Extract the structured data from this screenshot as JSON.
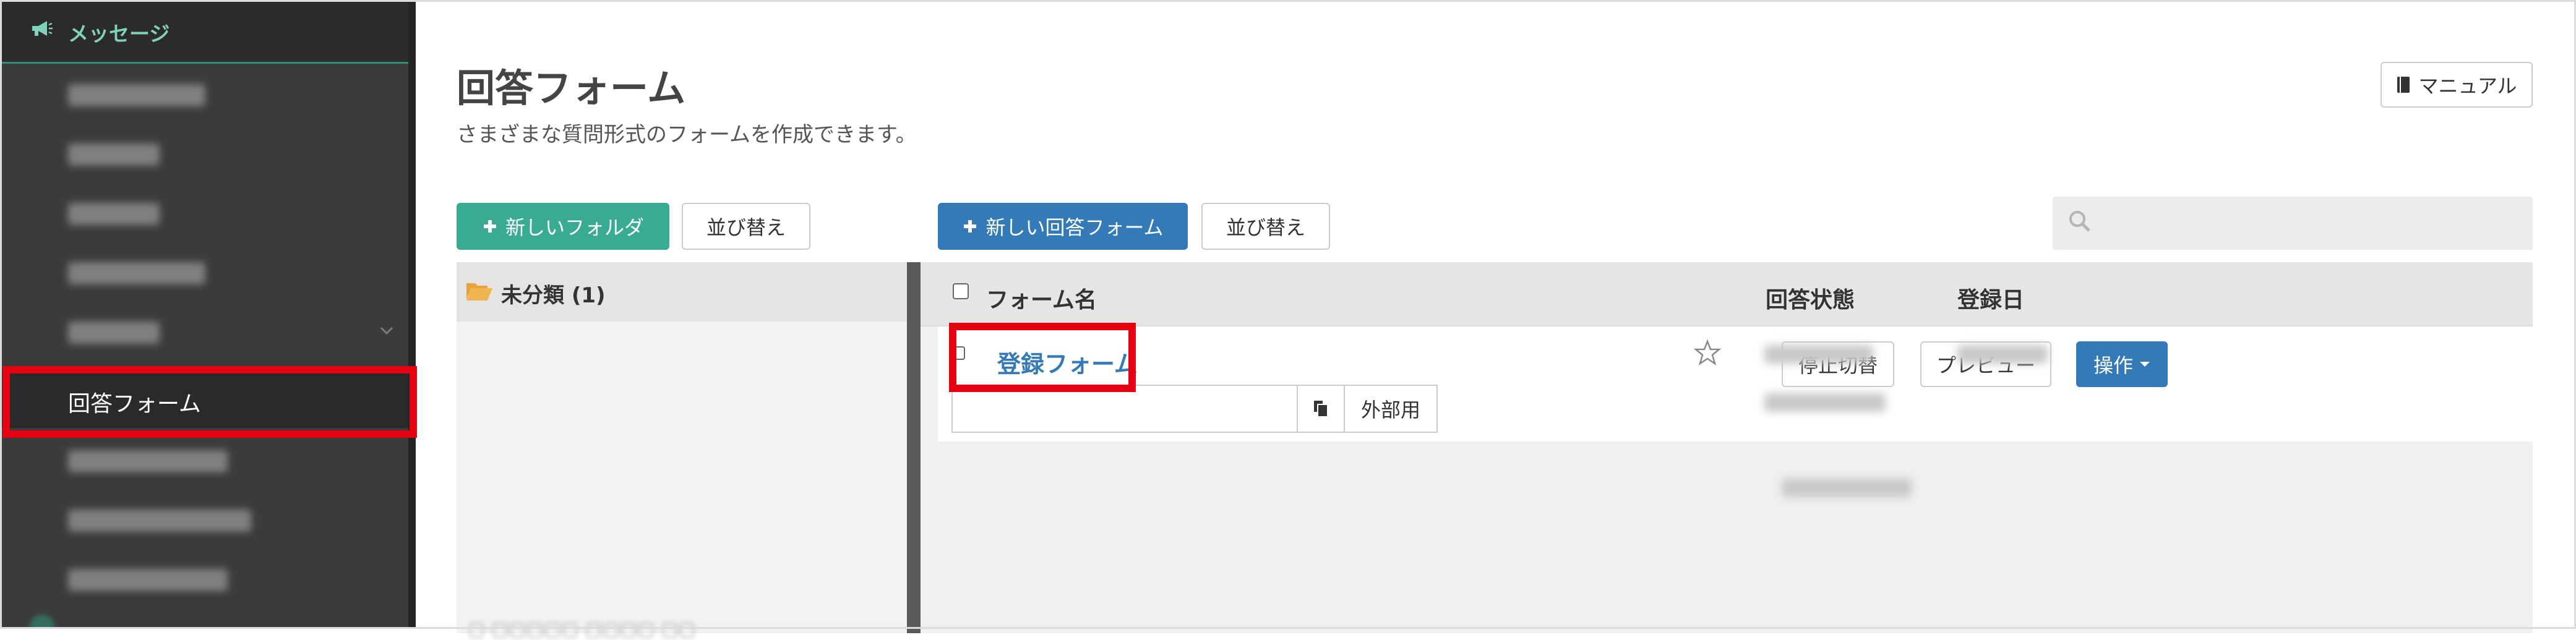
{
  "sidebar": {
    "header_label": "メッセージ",
    "active_item_label": "回答フォーム",
    "colors": {
      "background": "#3b3b3b",
      "header_text": "#7fd1bb",
      "accent": "#2e8f7a"
    }
  },
  "header": {
    "title": "回答フォーム",
    "subtitle": "さまざまな質問形式のフォームを作成できます。",
    "manual_label": "マニュアル"
  },
  "toolbar": {
    "new_folder_label": "新しいフォルダ",
    "sort_folder_label": "並び替え",
    "new_form_label": "新しい回答フォーム",
    "sort_form_label": "並び替え",
    "search_placeholder": ""
  },
  "folders": {
    "items": [
      {
        "label": "未分類 (1)"
      }
    ]
  },
  "table": {
    "headers": {
      "name": "フォーム名",
      "status": "回答状態",
      "date": "登録日"
    },
    "rows": [
      {
        "name": "登録フォーム",
        "url_value": "",
        "external_label": "外部用",
        "stop_label": "停止切替",
        "preview_label": "プレビュー",
        "ops_label": "操作"
      }
    ]
  },
  "colors": {
    "green": "#3aab93",
    "blue": "#337ab7",
    "highlight_red": "#e50012"
  }
}
